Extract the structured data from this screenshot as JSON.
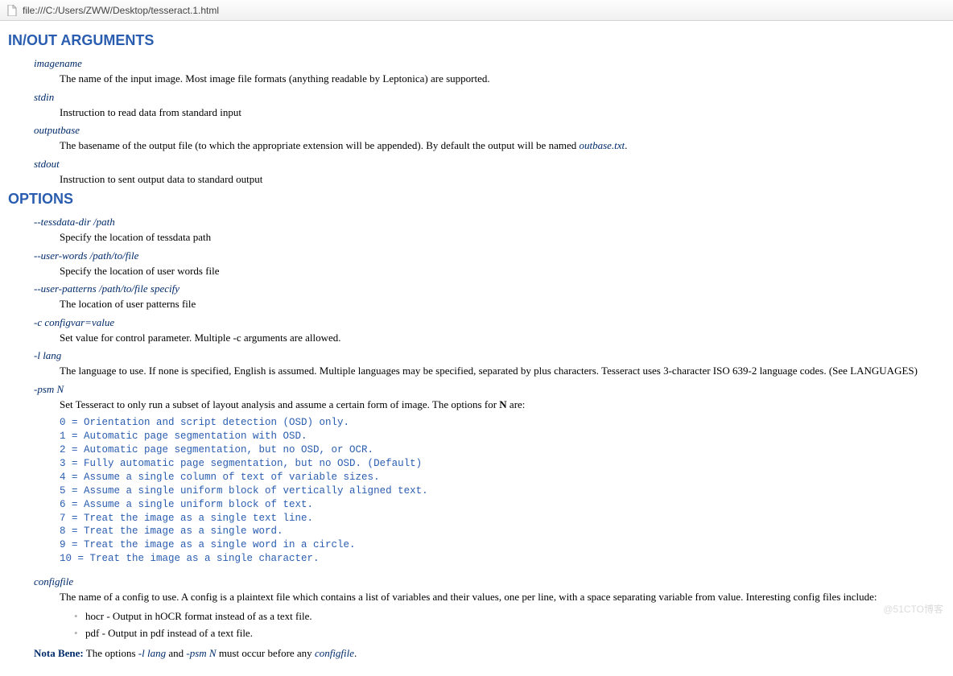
{
  "address_bar": {
    "url": "file:///C:/Users/ZWW/Desktop/tesseract.1.html"
  },
  "sections": {
    "inout": {
      "heading": "IN/OUT ARGUMENTS",
      "items": [
        {
          "term": "imagename",
          "desc_pre": "The name of the input image. Most image file formats (anything readable by Leptonica) are supported.",
          "desc_ref": "",
          "desc_post": ""
        },
        {
          "term": "stdin",
          "desc_pre": "Instruction to read data from standard input",
          "desc_ref": "",
          "desc_post": ""
        },
        {
          "term": "outputbase",
          "desc_pre": "The basename of the output file (to which the appropriate extension will be appended). By default the output will be named ",
          "desc_ref": "outbase.txt",
          "desc_post": "."
        },
        {
          "term": "stdout",
          "desc_pre": "Instruction to sent output data to standard output",
          "desc_ref": "",
          "desc_post": ""
        }
      ]
    },
    "options": {
      "heading": "OPTIONS",
      "items": [
        {
          "term": "--tessdata-dir /path",
          "desc": "Specify the location of tessdata path"
        },
        {
          "term": "--user-words /path/to/file",
          "desc": "Specify the location of user words file"
        },
        {
          "term": "--user-patterns /path/to/file specify",
          "desc": "The location of user patterns file"
        },
        {
          "term": "-c configvar=value",
          "desc": "Set value for control parameter. Multiple -c arguments are allowed."
        },
        {
          "term": "-l lang",
          "desc": "The language to use. If none is specified, English is assumed. Multiple languages may be specified, separated by plus characters. Tesseract uses 3-character ISO 639-2 language codes. (See LANGUAGES)"
        }
      ],
      "psm": {
        "term": "-psm N",
        "desc_pre": "Set Tesseract to only run a subset of layout analysis and assume a certain form of image. The options for ",
        "desc_bold": "N",
        "desc_post": " are:",
        "lines": [
          "0 = Orientation and script detection (OSD) only.",
          "1 = Automatic page segmentation with OSD.",
          "2 = Automatic page segmentation, but no OSD, or OCR.",
          "3 = Fully automatic page segmentation, but no OSD. (Default)",
          "4 = Assume a single column of text of variable sizes.",
          "5 = Assume a single uniform block of vertically aligned text.",
          "6 = Assume a single uniform block of text.",
          "7 = Treat the image as a single text line.",
          "8 = Treat the image as a single word.",
          "9 = Treat the image as a single word in a circle.",
          "10 = Treat the image as a single character."
        ]
      },
      "configfile": {
        "term": "configfile",
        "desc": "The name of a config to use. A config is a plaintext file which contains a list of variables and their values, one per line, with a space separating variable from value. Interesting config files include:",
        "sub": [
          "hocr - Output in hOCR format instead of as a text file.",
          "pdf - Output in pdf instead of a text file."
        ]
      },
      "nota": {
        "label": "Nota Bene:",
        "t1": " The options ",
        "o1": "-l lang",
        "t2": " and ",
        "o2": "-psm N",
        "t3": " must occur before any ",
        "o3": "configfile",
        "t4": "."
      }
    }
  },
  "watermark": "@51CTO博客"
}
